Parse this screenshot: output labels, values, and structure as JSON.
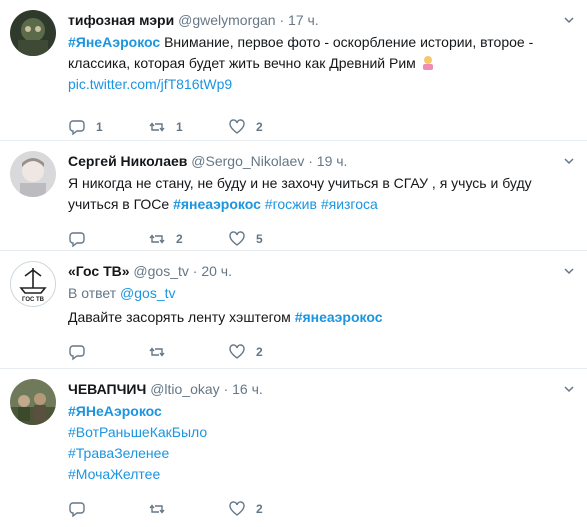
{
  "tweets": [
    {
      "name": "тифозная мэри",
      "handle": "@gwelymorgan",
      "dot": "·",
      "time": "17 ч.",
      "tag1": "#ЯнеАэрокос",
      "text1": " Внимание, первое фото - оскорбление истории, второе - классика, которая будет жить вечно как Древний Рим ",
      "link": "pic.twitter.com/jfT816tWp9",
      "replies": "1",
      "retweets": "1",
      "likes": "2"
    },
    {
      "name": "Сергей Николаев",
      "handle": "@Sergo_Nikolaev",
      "dot": "·",
      "time": "19 ч.",
      "text1": "Я никогда не стану, не буду и не захочу учиться в СГАУ , я учусь и буду учиться в ГОСе ",
      "tag1": "#янеаэрокос",
      "tag2": "#госжив",
      "tag3": "#яизгоса",
      "replies": "",
      "retweets": "2",
      "likes": "5"
    },
    {
      "name": "«Гос ТВ»",
      "handle": "@gos_tv",
      "dot": "·",
      "time": "20 ч.",
      "reply_prefix": "В ответ ",
      "reply_handle": "@gos_tv",
      "text1": "Давайте засорять ленту хэштегом ",
      "tag1": "#янеаэрокос",
      "avatar_label": "ГОС ТВ",
      "replies": "",
      "retweets": "",
      "likes": "2"
    },
    {
      "name": "ЧЕВАПЧИЧ",
      "handle": "@ltio_okay",
      "dot": "·",
      "time": "16 ч.",
      "tag1": "#ЯНеАэрокос",
      "tag2": "#ВотРаньшеКакБыло",
      "tag3": "#ТраваЗеленее",
      "tag4": "#МочаЖелтее",
      "replies": "",
      "retweets": "",
      "likes": "2"
    }
  ],
  "colors": {
    "link": "#1b95e0",
    "muted": "#657786",
    "border": "#e6ecf0"
  }
}
